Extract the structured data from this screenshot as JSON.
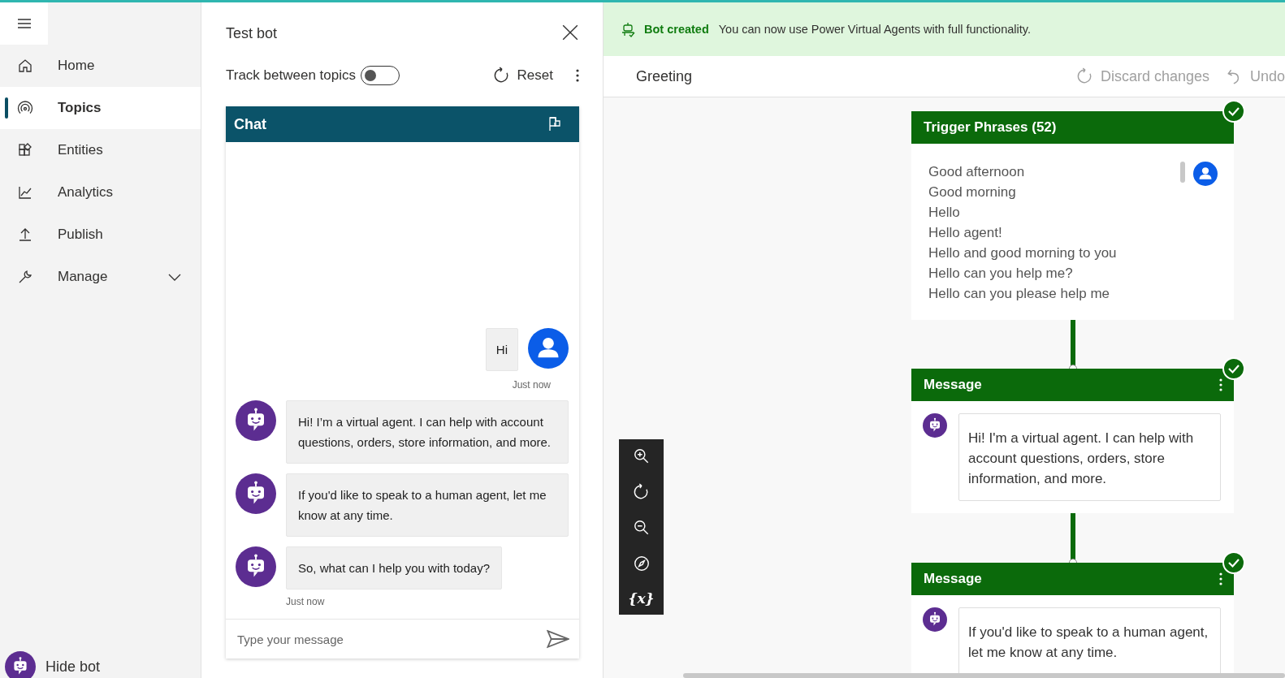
{
  "sidebar": {
    "items": [
      {
        "label": "Home",
        "selected": false,
        "expandable": false
      },
      {
        "label": "Topics",
        "selected": true,
        "expandable": false
      },
      {
        "label": "Entities",
        "selected": false,
        "expandable": false
      },
      {
        "label": "Analytics",
        "selected": false,
        "expandable": false
      },
      {
        "label": "Publish",
        "selected": false,
        "expandable": false
      },
      {
        "label": "Manage",
        "selected": false,
        "expandable": true
      }
    ],
    "footer": "Hide bot"
  },
  "test_bot": {
    "title": "Test bot",
    "track_toggle": {
      "label": "Track between topics",
      "on": false
    },
    "reset": "Reset",
    "chat_title": "Chat",
    "messages": [
      {
        "kind": "user",
        "text": "Hi",
        "time": "Just now"
      },
      {
        "kind": "bot",
        "text": "Hi! I’m a virtual agent. I can help with account questions, orders, store information, and more."
      },
      {
        "kind": "bot",
        "text": "If you'd like to speak to a human agent, let me know at any time."
      },
      {
        "kind": "bot",
        "text": "So, what can I help you with today?",
        "time": "Just now"
      }
    ],
    "input": {
      "placeholder": "Type your message"
    }
  },
  "banner": {
    "title": "Bot created",
    "text": "You can now use Power Virtual Agents with full functionality."
  },
  "topic": {
    "name": "Greeting",
    "discard": "Discard changes",
    "undo": "Undo"
  },
  "canvas": {
    "variables_label": "{x}",
    "nodes": [
      {
        "kind": "trigger",
        "title": "Trigger Phrases (52)",
        "valid": true,
        "phrases": [
          "Good afternoon",
          "Good morning",
          "Hello",
          "Hello agent!",
          "Hello and good morning to you",
          "Hello can you help me?",
          "Hello can you please help me"
        ]
      },
      {
        "kind": "message",
        "title": "Message",
        "valid": true,
        "text": "Hi! I'm a virtual agent. I can help with account questions, orders, store information, and more."
      },
      {
        "kind": "message",
        "title": "Message",
        "valid": true,
        "text": "If you'd like to speak to a human agent, let me know at any time."
      }
    ]
  }
}
